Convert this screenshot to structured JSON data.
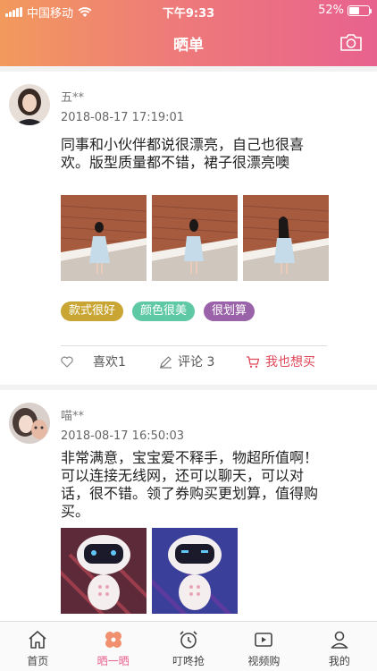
{
  "status_bar": {
    "carrier": "中国移动",
    "time": "下午9:33",
    "battery_percent": "52%",
    "battery_level": 0.52
  },
  "nav": {
    "title": "晒单",
    "camera_icon": "camera-icon"
  },
  "posts": [
    {
      "username": "五**",
      "date": "2018-08-17 17:19:01",
      "text": "同事和小伙伴都说很漂亮，自己也很喜欢。版型质量都不错，裙子很漂亮噢",
      "tags": [
        {
          "label": "款式很好",
          "color": "#c9a633"
        },
        {
          "label": "颜色很美",
          "color": "#5fc8a5"
        },
        {
          "label": "很划算",
          "color": "#9a62a8"
        }
      ],
      "like_label": "喜欢1",
      "comment_label": "评论 3",
      "buy_label": "我也想买"
    },
    {
      "username": "喵**",
      "date": "2018-08-17 16:50:03",
      "text": "非常满意，宝宝爱不释手，物超所值啊！可以连接无线网，还可以聊天，可以对话，很不错。领了券购买更划算，值得购买。"
    }
  ],
  "tabbar": {
    "items": [
      {
        "label": "首页",
        "icon": "home-icon"
      },
      {
        "label": "晒一晒",
        "icon": "flower-icon"
      },
      {
        "label": "叮咚抢",
        "icon": "alarm-clock-icon"
      },
      {
        "label": "视频购",
        "icon": "video-icon"
      },
      {
        "label": "我的",
        "icon": "user-icon"
      }
    ],
    "active_index": 1,
    "active_color": "#e8628e"
  }
}
